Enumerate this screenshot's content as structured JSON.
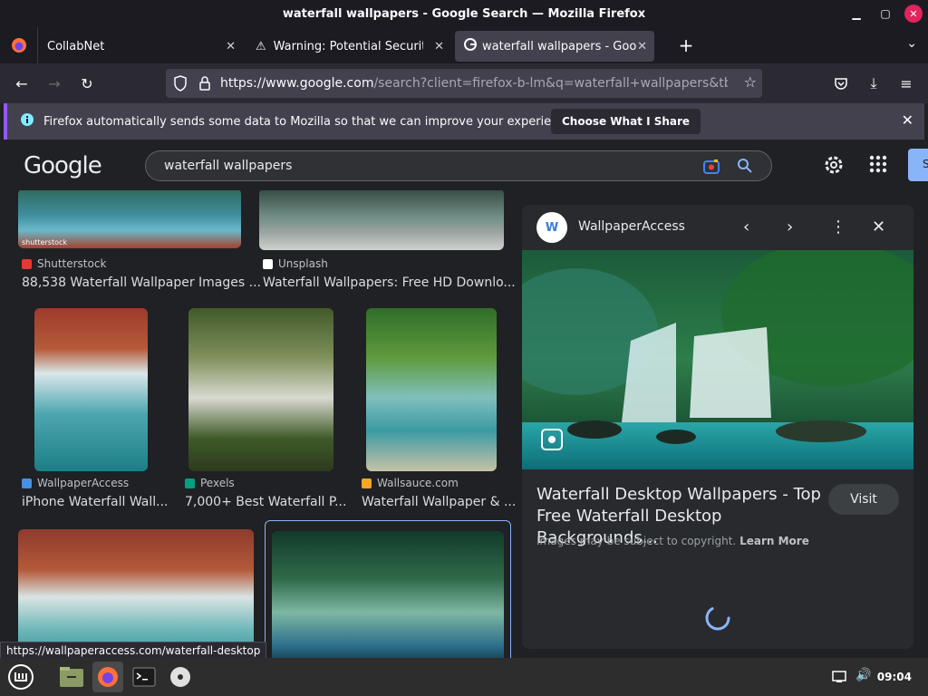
{
  "window": {
    "title": "waterfall wallpapers - Google Search — Mozilla Firefox"
  },
  "tabs": [
    {
      "label": "CollabNet"
    },
    {
      "label": "Warning: Potential Security"
    },
    {
      "label": "waterfall wallpapers - Goo"
    }
  ],
  "navbar": {
    "url_host": "https://www.google.com",
    "url_path": "/search?client=firefox-b-lm&q=waterfall+wallpapers&tbm=isch&"
  },
  "notification": {
    "message": "Firefox automatically sends some data to Mozilla so that we can improve your experience.",
    "button": "Choose What I Share"
  },
  "google": {
    "logo": "Google",
    "query": "waterfall wallpapers",
    "signin": "S"
  },
  "results": [
    {
      "source": "Shutterstock",
      "title": "88,538 Waterfall Wallpaper Images ...",
      "fav_color": "#e53935"
    },
    {
      "source": "Unsplash",
      "title": "Waterfall Wallpapers: Free HD Downlo...",
      "fav_color": "#ffffff"
    },
    {
      "source": "WallpaperAccess",
      "title": "iPhone Waterfall Wall...",
      "fav_color": "#4a90e2"
    },
    {
      "source": "Pexels",
      "title": "7,000+ Best Waterfall P...",
      "fav_color": "#05a081"
    },
    {
      "source": "Wallsauce.com",
      "title": "Waterfall Wallpaper & ...",
      "fav_color": "#f5a623"
    }
  ],
  "preview": {
    "site_logo": "W",
    "site": "WallpaperAccess",
    "title": "Waterfall Desktop Wallpapers - Top Free Waterfall Desktop Backgrounds...",
    "visit": "Visit",
    "copyright": "Images may be subject to copyright.",
    "learn_more": "Learn More"
  },
  "status_link": "https://wallpaperaccess.com/waterfall-desktop",
  "taskbar": {
    "clock": "09:04"
  }
}
